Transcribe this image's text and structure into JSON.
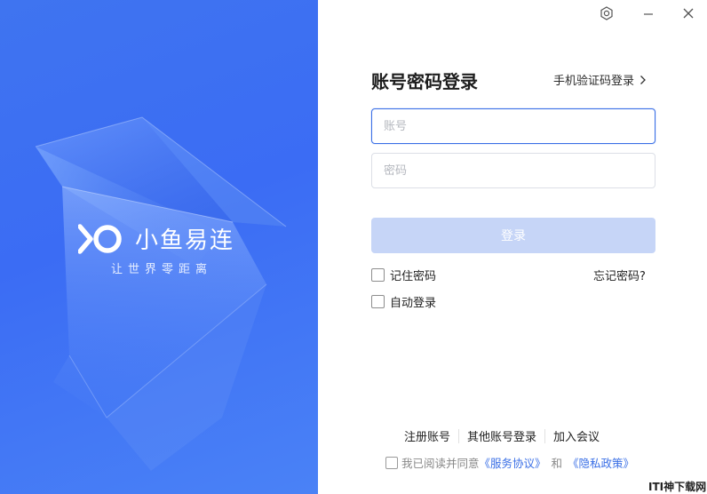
{
  "brand": {
    "name": "小鱼易连",
    "slogan": "让世界零距离"
  },
  "window_controls": {
    "settings_icon": "gear-icon",
    "minimize_icon": "minimize-icon",
    "close_icon": "close-icon"
  },
  "form": {
    "title": "账号密码登录",
    "sms_login_link": "手机验证码登录",
    "account_placeholder": "账号",
    "account_value": "",
    "password_placeholder": "密码",
    "password_value": "",
    "login_button": "登录",
    "remember_password": "记住密码",
    "remember_password_checked": false,
    "forgot_password": "忘记密码?",
    "auto_login": "自动登录",
    "auto_login_checked": false
  },
  "footer": {
    "register": "注册账号",
    "other_login": "其他账号登录",
    "join_meeting": "加入会议",
    "agree_prefix": "我已阅读并同意",
    "service_agreement": "《服务协议》",
    "and": "和",
    "privacy_policy": "《隐私政策》",
    "agree_checked": false
  },
  "watermark": "ITI神下载网",
  "colors": {
    "brand_blue": "#3b6cf4",
    "accent_blue": "#3a6fe6",
    "login_button_disabled": "#c6d5f7"
  }
}
